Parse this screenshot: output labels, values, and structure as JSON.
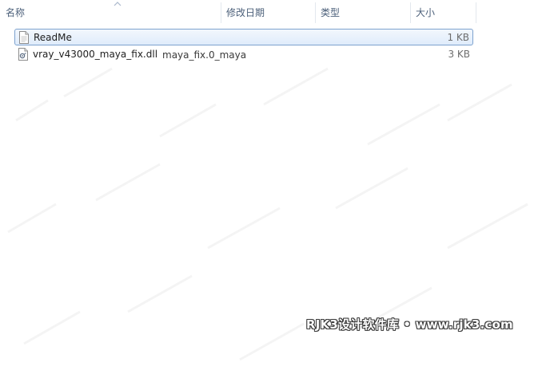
{
  "columns": {
    "name": "名称",
    "modified": "修改日期",
    "type": "类型",
    "size": "大小"
  },
  "files": [
    {
      "name": "ReadMe",
      "size": "1 KB",
      "icon": "text-file-icon",
      "selected": true
    },
    {
      "name": "vray_v43000_maya_fix.dll",
      "size": "3 KB",
      "icon": "dll-file-icon",
      "selected": false
    }
  ],
  "ghost_text": "maya_fix.0_maya",
  "watermark": "RJK3设计软件库 • www.rjk3.com",
  "colors": {
    "selection_border": "#7da2ce",
    "header_text": "#4c607a"
  }
}
